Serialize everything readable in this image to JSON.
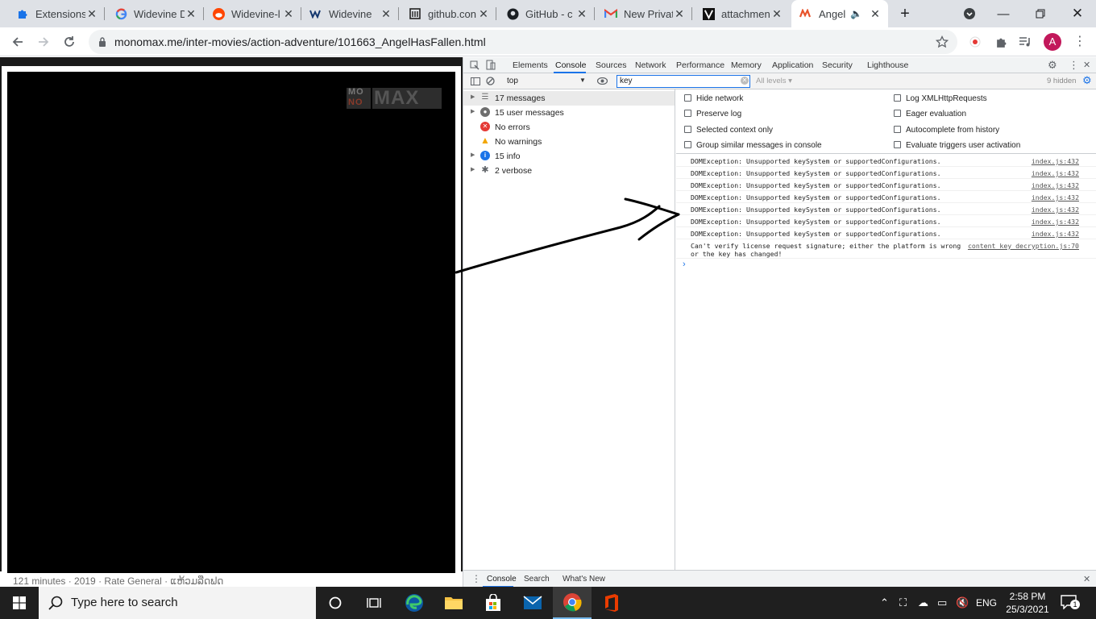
{
  "tabs": [
    {
      "title": "Extensions",
      "icon": "puzzle-icon"
    },
    {
      "title": "Widevine D",
      "icon": "google-icon"
    },
    {
      "title": "Widevine-l",
      "icon": "reddit-icon"
    },
    {
      "title": "Widevine",
      "icon": "widevine-icon"
    },
    {
      "title": "github.con",
      "icon": "archive-icon"
    },
    {
      "title": "GitHub - c",
      "icon": "github-icon"
    },
    {
      "title": "New Privat",
      "icon": "gmail-icon"
    },
    {
      "title": "attachmen",
      "icon": "v-icon"
    },
    {
      "title": "Angel",
      "icon": "monomax-icon"
    }
  ],
  "address_bar": {
    "url": "monomax.me/inter-movies/action-adventure/101663_AngelHasFallen.html"
  },
  "profile_initial": "A",
  "page": {
    "logo_top": "MO",
    "logo_bottom": "NO",
    "logo_main": "MAX",
    "meta": "121 minutes  ·  2019  ·  Rate General  ·  ແຫ້ວມລືດຟດ"
  },
  "devtools": {
    "tabs": [
      "Elements",
      "Console",
      "Sources",
      "Network",
      "Performance",
      "Memory",
      "Application",
      "Security",
      "Lighthouse"
    ],
    "context": "top",
    "filter_value": "key",
    "levels": "All levels ▾",
    "hidden_count": "9 hidden",
    "sidebar": [
      {
        "label": "17 messages",
        "icon": "list-icon"
      },
      {
        "label": "15 user messages",
        "icon": "user-icon"
      },
      {
        "label": "No errors",
        "icon": "error-icon"
      },
      {
        "label": "No warnings",
        "icon": "warning-icon"
      },
      {
        "label": "15 info",
        "icon": "info-icon"
      },
      {
        "label": "2 verbose",
        "icon": "verbose-icon"
      }
    ],
    "settings": {
      "left": [
        "Hide network",
        "Preserve log",
        "Selected context only",
        "Group similar messages in console"
      ],
      "right": [
        "Log XMLHttpRequests",
        "Eager evaluation",
        "Autocomplete from history",
        "Evaluate triggers user activation"
      ]
    },
    "log": [
      {
        "msg": "DOMException: Unsupported keySystem or supportedConfigurations.",
        "src": "index.js:432"
      },
      {
        "msg": "DOMException: Unsupported keySystem or supportedConfigurations.",
        "src": "index.js:432"
      },
      {
        "msg": "DOMException: Unsupported keySystem or supportedConfigurations.",
        "src": "index.js:432"
      },
      {
        "msg": "DOMException: Unsupported keySystem or supportedConfigurations.",
        "src": "index.js:432"
      },
      {
        "msg": "DOMException: Unsupported keySystem or supportedConfigurations.",
        "src": "index.js:432"
      },
      {
        "msg": "DOMException: Unsupported keySystem or supportedConfigurations.",
        "src": "index.js:432"
      },
      {
        "msg": "DOMException: Unsupported keySystem or supportedConfigurations.",
        "src": "index.js:432"
      }
    ],
    "log_last": {
      "line1": "Can't verify license request signature; either the platform is wrong",
      "line2": "or the key has changed!",
      "src": "content_key_decryption.js:70"
    },
    "drawer_tabs": [
      "Console",
      "Search",
      "What's New"
    ]
  },
  "taskbar": {
    "search_placeholder": "Type here to search",
    "lang": "ENG",
    "time": "2:58 PM",
    "date": "25/3/2021",
    "notifications": "1"
  },
  "colors": {
    "accent": "#1a73e8",
    "tabstrip": "#dee1e6",
    "taskbar": "#1f1f1f"
  }
}
